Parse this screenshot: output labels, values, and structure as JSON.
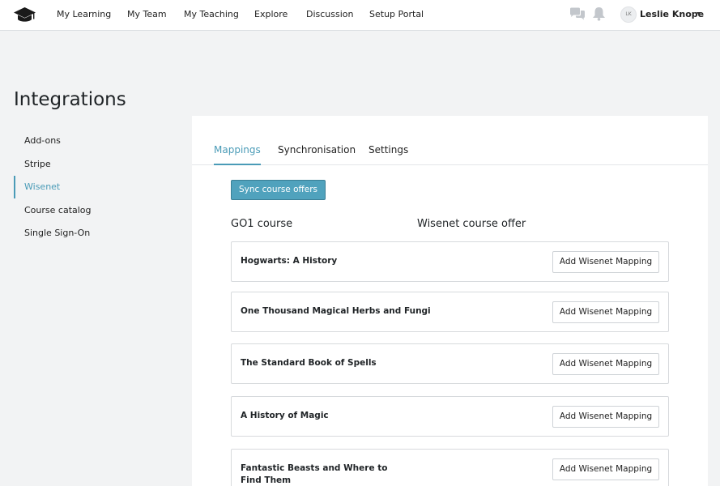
{
  "nav": {
    "items": [
      "My Learning",
      "My Team",
      "My Teaching",
      "Explore",
      "Discussion",
      "Setup Portal"
    ],
    "avatar_initials": "LK",
    "user_name": "Leslie Knope"
  },
  "page": {
    "title": "Integrations"
  },
  "sidebar": {
    "items": [
      {
        "label": "Add-ons",
        "active": false
      },
      {
        "label": "Stripe",
        "active": false
      },
      {
        "label": "Wisenet",
        "active": true
      },
      {
        "label": "Course catalog",
        "active": false
      },
      {
        "label": "Single Sign-On",
        "active": false
      }
    ]
  },
  "tabs": [
    {
      "label": "Mappings",
      "active": true
    },
    {
      "label": "Synchronisation",
      "active": false
    },
    {
      "label": "Settings",
      "active": false
    }
  ],
  "sync_button": "Sync course offers",
  "columns": {
    "left": "GO1 course",
    "right": "Wisenet course offer"
  },
  "courses": [
    {
      "title": "Hogwarts: A History",
      "action": "Add Wisenet Mapping"
    },
    {
      "title": "One Thousand Magical Herbs and Fungi",
      "action": "Add Wisenet Mapping"
    },
    {
      "title": "The Standard Book of Spells",
      "action": "Add Wisenet Mapping"
    },
    {
      "title": "A History of Magic",
      "action": "Add Wisenet Mapping"
    },
    {
      "title": "Fantastic Beasts and Where to Find Them",
      "action": "Add Wisenet Mapping"
    }
  ],
  "colors": {
    "accent": "#4a9bb7",
    "button": "#50a2bd",
    "background": "#f2f3f4"
  }
}
